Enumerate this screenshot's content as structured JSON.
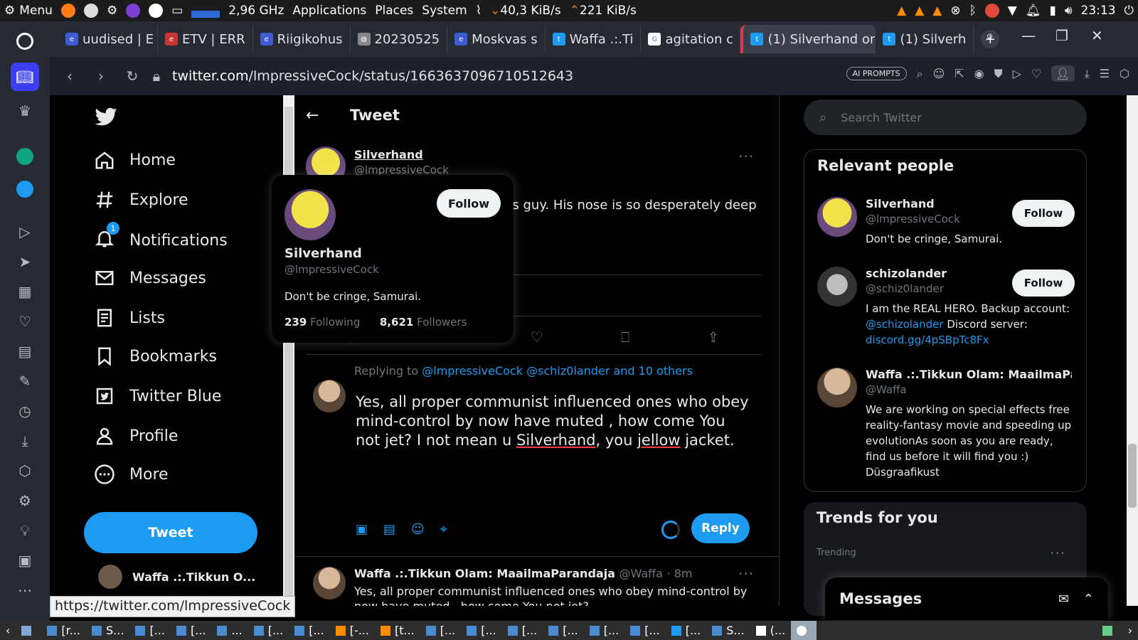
{
  "os_panel": {
    "menu_label": "Menu",
    "cpu_freq": "2,96 GHz",
    "menus": [
      "Applications",
      "Places",
      "System"
    ],
    "net_down": "40,3 KiB/s",
    "net_up": "221 KiB/s",
    "clock": "23:13"
  },
  "browser": {
    "tabs": [
      {
        "label": "uudised | E",
        "active": false
      },
      {
        "label": "ETV | ERR",
        "active": false
      },
      {
        "label": "Riigikohus",
        "active": false
      },
      {
        "label": "20230525",
        "active": false
      },
      {
        "label": "Moskvas s",
        "active": false
      },
      {
        "label": "Waffa .:.Ti",
        "active": false
      },
      {
        "label": "agitation c",
        "active": false
      },
      {
        "label": "(1) Silverhand on",
        "active": true
      },
      {
        "label": "(1) Silverh",
        "active": false
      }
    ],
    "url_host": "twitter.com",
    "url_path": "/lmpressiveCock/status/1663637096710512643",
    "ai_prompts_label": "AI PROMPTS",
    "status_bar_url": "https://twitter.com/lmpressiveCock"
  },
  "twitter_nav": {
    "items": [
      {
        "label": "Home",
        "icon": "home-icon"
      },
      {
        "label": "Explore",
        "icon": "hash-icon"
      },
      {
        "label": "Notifications",
        "icon": "bell-icon",
        "badge": "1"
      },
      {
        "label": "Messages",
        "icon": "mail-icon"
      },
      {
        "label": "Lists",
        "icon": "list-icon"
      },
      {
        "label": "Bookmarks",
        "icon": "bookmark-icon"
      },
      {
        "label": "Twitter Blue",
        "icon": "twitter-blue-icon"
      },
      {
        "label": "Profile",
        "icon": "person-icon"
      },
      {
        "label": "More",
        "icon": "more-circle-icon"
      }
    ],
    "tweet_button": "Tweet",
    "account_name": "Waffa .:.Tikkun O..."
  },
  "main": {
    "header_title": "Tweet",
    "author_name": "Silverhand",
    "author_handle": "@lmpressiveCock",
    "tweet_fragment": "his guy. His nose is so desperately deep",
    "reply_prefix": "Replying to ",
    "reply_targets": "@lmpressiveCock @schiz0lander and 10 others",
    "reply_draft_part1": "Yes, all proper communist  influenced ones who obey mind-control by now have muted , how come You not jet?   I not mean u ",
    "reply_draft_word1": "Silverhand",
    "reply_draft_part2": ", you ",
    "reply_draft_word2": "jellow",
    "reply_draft_part3": " jacket.",
    "reply_button": "Reply",
    "next_tweet": {
      "name": "Waffa .:.Tikkun Olam: MaailmaParandaja",
      "handle": "@Waffa",
      "time": "· 8m",
      "text": "Yes, all proper communist  influenced ones who obey mind-control by now have muted , how come You not jet?"
    }
  },
  "hovercard": {
    "name": "Silverhand",
    "handle": "@lmpressiveCock",
    "bio": "Don't be cringe, Samurai.",
    "following_count": "239",
    "following_label": "Following",
    "followers_count": "8,621",
    "followers_label": "Followers",
    "follow_button": "Follow"
  },
  "right": {
    "search_placeholder": "Search Twitter",
    "relevant_title": "Relevant people",
    "people": [
      {
        "name": "Silverhand",
        "handle": "@lmpressiveCock",
        "bio": "Don't be cringe, Samurai.",
        "follow": "Follow"
      },
      {
        "name": "schizolander",
        "handle": "@schiz0lander",
        "bio_part1": "I am the REAL HERO. Backup account: ",
        "bio_link1": "@schizolander",
        "bio_part2": " Discord server: ",
        "bio_link2": "discord.gg/4pSBpTc8Fx",
        "follow": "Follow"
      },
      {
        "name": "Waffa .:.Tikkun Olam: MaailmaPar...",
        "handle": "@Waffa",
        "bio": "We are working on special effects free reality-fantasy movie and speeding up evolutionAs soon as you are ready, find us before it will find you :) Düsgraafikust"
      }
    ],
    "trends_title": "Trends for you",
    "trend_meta": "Trending",
    "messages_title": "Messages"
  },
  "taskbar": {
    "items": [
      "[r...",
      "S...",
      "[...",
      "[...",
      "...",
      "[...",
      "[...",
      "[-...",
      "[t...",
      "[...",
      "[...",
      "[...",
      "[...",
      "[...",
      "[...",
      "[...",
      "S...",
      "(..."
    ]
  },
  "colors": {
    "accent": "#1d9bf0",
    "background": "#000000",
    "opera_accent": "#3b3ff0"
  }
}
